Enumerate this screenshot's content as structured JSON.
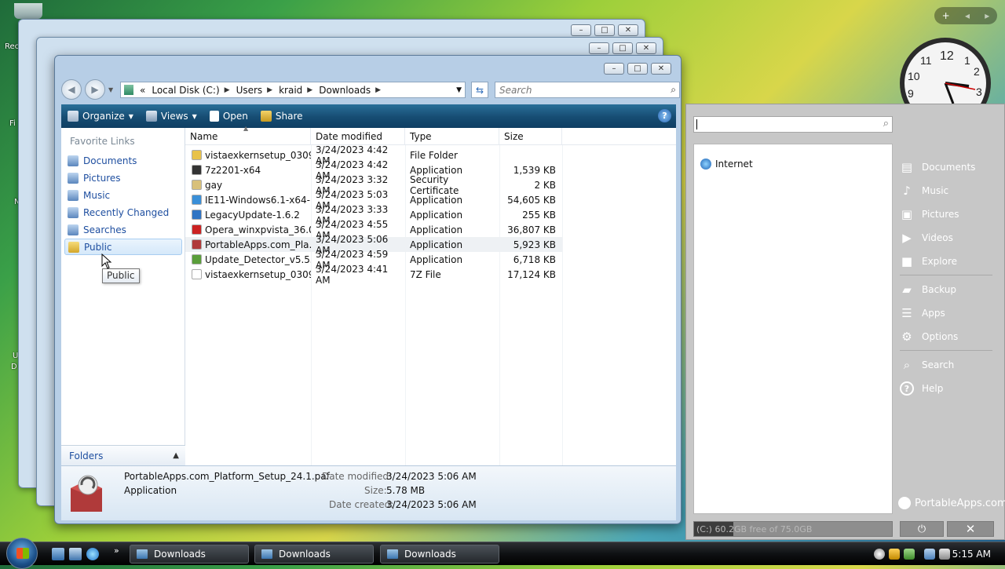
{
  "desktop": {
    "icon_labels": [
      "Rec",
      "Fi",
      "N",
      "U",
      "D"
    ]
  },
  "explorer": {
    "breadcrumb": [
      "Local Disk (C:)",
      "Users",
      "kraid",
      "Downloads"
    ],
    "breadcrumb_prefix": "«",
    "search_placeholder": "Search",
    "toolbar": {
      "organize": "Organize",
      "views": "Views",
      "open": "Open",
      "share": "Share",
      "help": "?"
    },
    "nav": {
      "title": "Favorite Links",
      "items": [
        "Documents",
        "Pictures",
        "Music",
        "Recently Changed",
        "Searches",
        "Public"
      ],
      "selected": "Public",
      "folders_label": "Folders"
    },
    "columns": [
      "Name",
      "Date modified",
      "Type",
      "Size"
    ],
    "files": [
      {
        "name": "vistaexkernsetup_0309....",
        "date": "3/24/2023 4:42 AM",
        "type": "File Folder",
        "size": "",
        "icon": "folder-icon",
        "color": "#e8c24a"
      },
      {
        "name": "7z2201-x64",
        "date": "3/24/2023 4:42 AM",
        "type": "Application",
        "size": "1,539 KB",
        "icon": "7zip-icon",
        "color": "#333333"
      },
      {
        "name": "gay",
        "date": "3/24/2023 3:32 AM",
        "type": "Security Certificate",
        "size": "2 KB",
        "icon": "certificate-icon",
        "color": "#d8c07a"
      },
      {
        "name": "IE11-Windows6.1-x64-...",
        "date": "3/24/2023 5:03 AM",
        "type": "Application",
        "size": "54,605 KB",
        "icon": "ie-icon",
        "color": "#3a8fd8"
      },
      {
        "name": "LegacyUpdate-1.6.2",
        "date": "3/24/2023 3:33 AM",
        "type": "Application",
        "size": "255 KB",
        "icon": "update-icon",
        "color": "#2f74c4"
      },
      {
        "name": "Opera_winxpvista_36.0....",
        "date": "3/24/2023 4:55 AM",
        "type": "Application",
        "size": "36,807 KB",
        "icon": "opera-icon",
        "color": "#cc2222"
      },
      {
        "name": "PortableApps.com_Pla...",
        "date": "3/24/2023 5:06 AM",
        "type": "Application",
        "size": "5,923 KB",
        "icon": "portableapps-icon",
        "color": "#b03a3a"
      },
      {
        "name": "Update_Detector_v5.53...",
        "date": "3/24/2023 4:59 AM",
        "type": "Application",
        "size": "6,718 KB",
        "icon": "detector-icon",
        "color": "#5a9e3a"
      },
      {
        "name": "vistaexkernsetup_0309....",
        "date": "3/24/2023 4:41 AM",
        "type": "7Z File",
        "size": "17,124 KB",
        "icon": "file-icon",
        "color": "#ffffff"
      }
    ],
    "selected_row": 6,
    "details": {
      "filename": "PortableApps.com_Platform_Setup_24.1.paf",
      "type": "Application",
      "date_modified_label": "Date modified:",
      "date_modified": "3/24/2023 5:06 AM",
      "size_label": "Size:",
      "size": "5.78 MB",
      "date_created_label": "Date created:",
      "date_created": "3/24/2023 5:06 AM"
    },
    "tooltip": "Public"
  },
  "portableapps": {
    "list_items": [
      "Internet"
    ],
    "links": [
      "Documents",
      "Music",
      "Pictures",
      "Videos",
      "Explore",
      "Backup",
      "Apps",
      "Options",
      "Search",
      "Help"
    ],
    "brand": "PortableApps.com",
    "disk_free": "(C:) 60.2GB free of 75.0GB",
    "disk_used_fraction": 0.2
  },
  "taskbar": {
    "tasks": [
      "Downloads",
      "Downloads",
      "Downloads"
    ],
    "clock": "5:15 AM"
  },
  "gadgets": {
    "add": "+",
    "prev": "◂",
    "next": "▸"
  }
}
